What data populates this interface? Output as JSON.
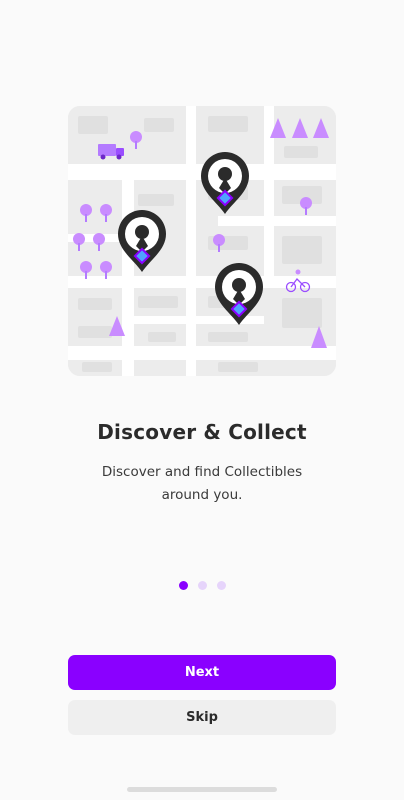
{
  "onboarding": {
    "title": "Discover & Collect",
    "subtitle": "Discover and find Collectibles around you.",
    "page_indicator": {
      "current": 1,
      "total": 3
    },
    "next_label": "Next",
    "skip_label": "Skip"
  },
  "illustration": {
    "icons": [
      "map-pin-icon",
      "tree-icon",
      "pine-tree-icon",
      "truck-icon",
      "cyclist-icon",
      "collectible-gem-icon"
    ]
  },
  "colors": {
    "accent": "#8a00ff",
    "accent_light": "#c98cff",
    "map_background": "#ececec",
    "map_roads": "#ffffff",
    "pin_dark": "#2b2b2b"
  }
}
